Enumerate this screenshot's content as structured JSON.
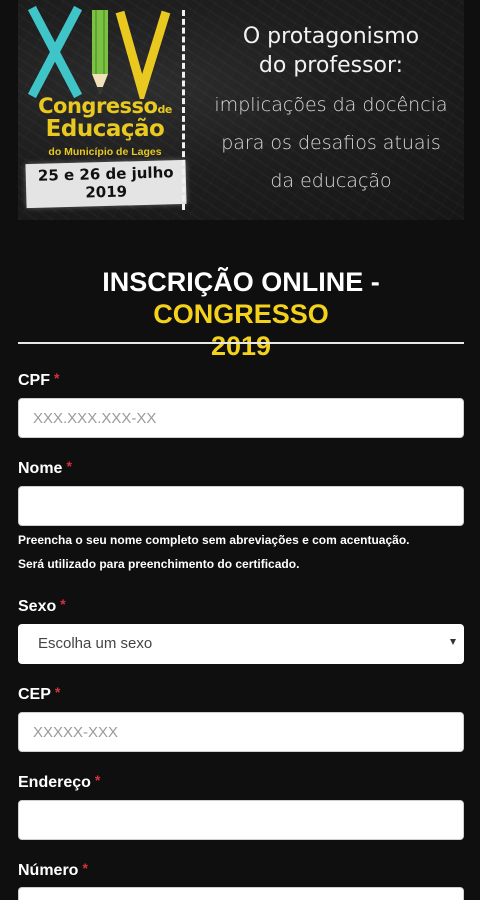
{
  "banner": {
    "roman_numeral": "XIV",
    "logo": {
      "line1": "Congresso",
      "line1_suffix": "de",
      "line2": "Educação",
      "line3": "do Município de Lages",
      "date_line1": "25 e 26 de julho",
      "date_line2": "2019"
    },
    "tagline": {
      "line1": "O protagonismo",
      "line2": "do professor:",
      "line3": "implicações da docência",
      "line4": "para os desafios atuais",
      "line5": "da educação"
    },
    "colors": {
      "yellow": "#e9c920",
      "teal": "#3fc4c8",
      "green": "#7bc142"
    }
  },
  "form": {
    "title_white": "INSCRIÇÃO ONLINE - ",
    "title_yellow_1": "CONGRESSO",
    "title_yellow_2": "2019",
    "required_mark": "*",
    "fields": {
      "cpf": {
        "label": "CPF",
        "placeholder": "XXX.XXX.XXX-XX",
        "value": ""
      },
      "nome": {
        "label": "Nome",
        "placeholder": "",
        "value": "",
        "help_line1": "Preencha o seu nome completo sem abreviações e com acentuação.",
        "help_line2": "Será utilizado para preenchimento do certificado."
      },
      "sexo": {
        "label": "Sexo",
        "selected": "Escolha um sexo"
      },
      "cep": {
        "label": "CEP",
        "placeholder": "XXXXX-XXX",
        "value": ""
      },
      "endereco": {
        "label": "Endereço",
        "placeholder": "",
        "value": ""
      },
      "numero": {
        "label": "Número",
        "placeholder": "",
        "value": ""
      }
    }
  }
}
